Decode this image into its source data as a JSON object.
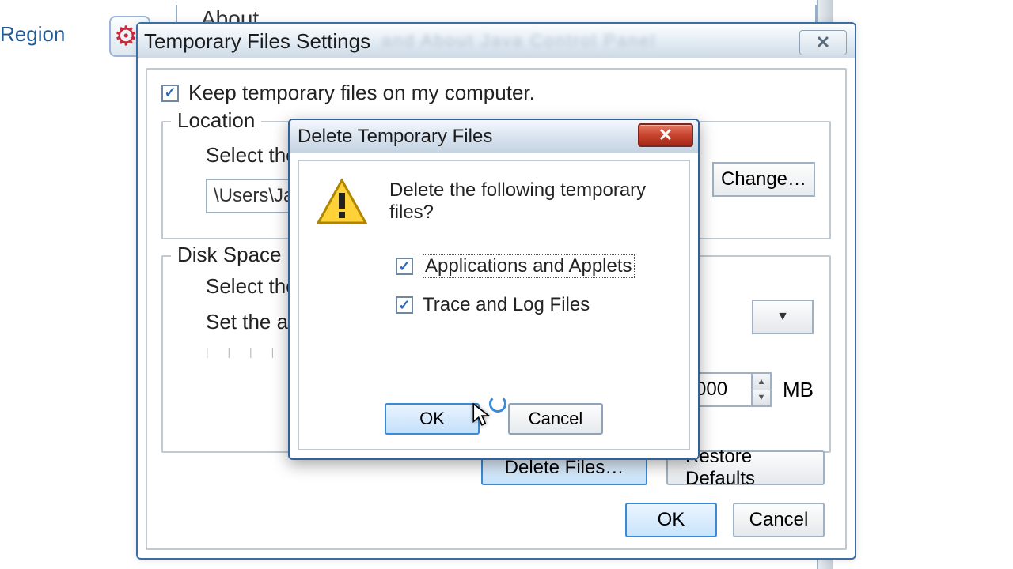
{
  "background": {
    "region_label": "Region",
    "about_label": "About"
  },
  "settings": {
    "title": "Temporary Files Settings",
    "keep_checkbox_label": "Keep temporary files on my computer.",
    "keep_checked": true,
    "location": {
      "legend": "Location",
      "prompt": "Select the l",
      "path_value": "\\Users\\Jam",
      "change_btn": "Change…"
    },
    "diskspace": {
      "legend": "Disk Space",
      "line1": "Select the c",
      "line2": "Set the am",
      "spin_value": "000",
      "unit": "MB"
    },
    "actions": {
      "delete_files": "Delete Files…",
      "restore_defaults": "Restore Defaults"
    },
    "bottom": {
      "ok": "OK",
      "cancel": "Cancel"
    }
  },
  "delete": {
    "title": "Delete Temporary Files",
    "message": "Delete the following temporary files?",
    "options": [
      {
        "label": "Applications and Applets",
        "checked": true,
        "focused": true
      },
      {
        "label": "Trace and Log Files",
        "checked": true,
        "focused": false
      }
    ],
    "ok": "OK",
    "cancel": "Cancel"
  }
}
